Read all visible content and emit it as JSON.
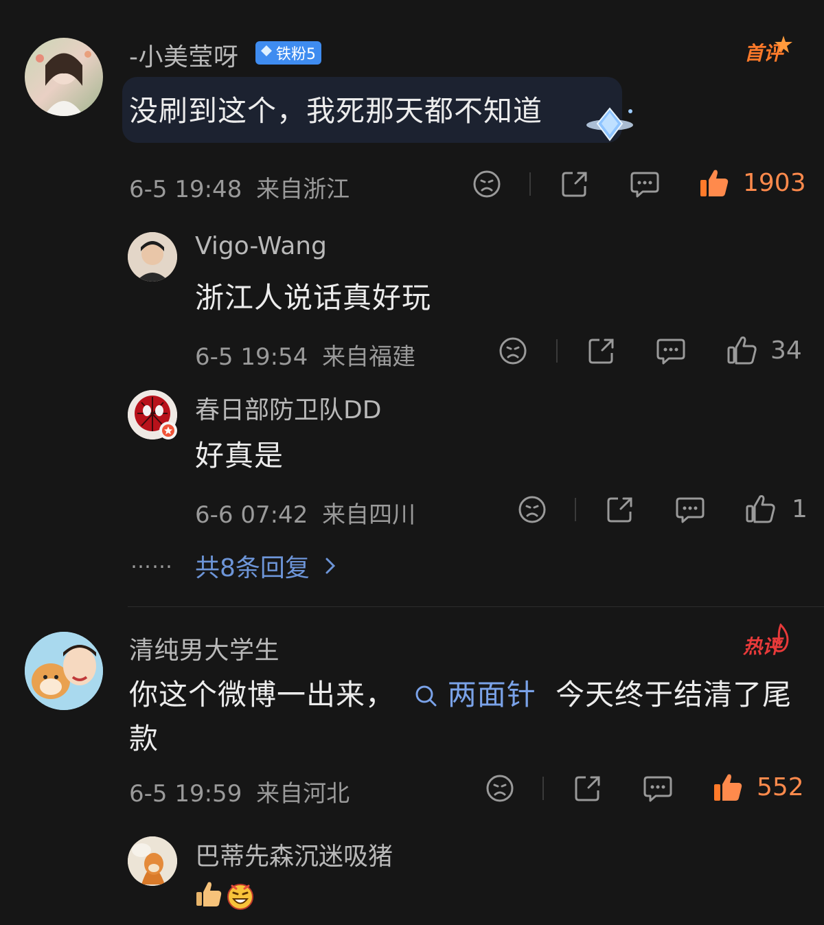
{
  "comments": [
    {
      "username": "-小美莹呀",
      "badge": "铁粉5",
      "tag": "首评",
      "text": "没刷到这个，我死那天都不知道",
      "time": "6-5 19:48",
      "location": "来自浙江",
      "likes": "1903",
      "replies": [
        {
          "username": "Vigo-Wang",
          "text": "浙江人说话真好玩",
          "time": "6-5 19:54",
          "location": "来自福建",
          "likes": "34"
        },
        {
          "username": "春日部防卫队DD",
          "text": "好真是",
          "time": "6-6 07:42",
          "location": "来自四川",
          "likes": "1"
        }
      ],
      "more_dots": "……",
      "more_replies": "共8条回复"
    },
    {
      "username": "清纯男大学生",
      "tag": "热评",
      "text_before": "你这个微博一出来，",
      "topic": "两面针",
      "text_after_line1": "今天终于结清了尾",
      "text_line2": "款",
      "time": "6-5 19:59",
      "location": "来自河北",
      "likes": "552",
      "replies": [
        {
          "username": "巴蒂先森沉迷吸猪"
        }
      ]
    }
  ],
  "colors": {
    "background": "#161616",
    "like_active": "#ff8a4c",
    "link": "#6d95d8",
    "badge": "#3f8cf0"
  }
}
